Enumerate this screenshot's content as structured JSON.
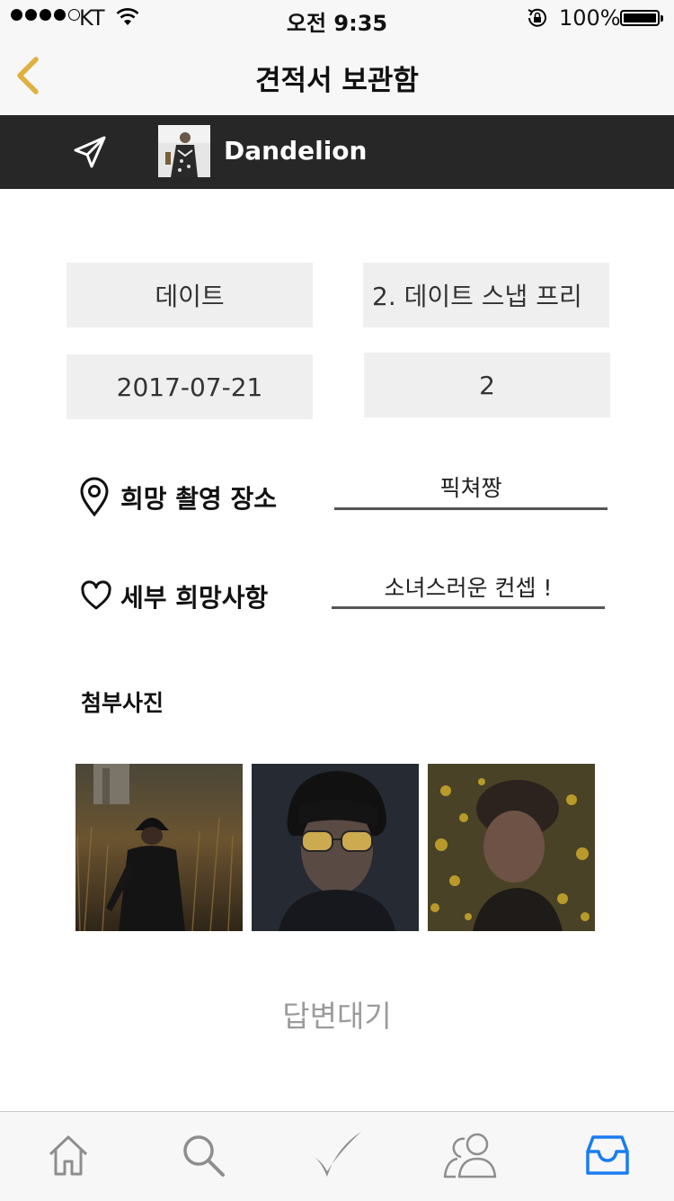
{
  "status_bar": {
    "carrier": "KT",
    "time": "오전 9:35",
    "battery_percent": "100%",
    "signal_bars": 4,
    "signal_total": 5
  },
  "nav": {
    "title": "견적서 보관함",
    "back_icon": "chevron-left-icon",
    "accent_color": "#e0b040"
  },
  "profile": {
    "name": "Dandelion",
    "send_icon": "paper-plane-icon"
  },
  "request": {
    "category": "데이트",
    "package": "2. 데이트 스냅 프리",
    "date": "2017-07-21",
    "count": "2"
  },
  "fields": {
    "location_label": "희망 촬영 장소",
    "location_value": "픽쳐짱",
    "location_icon": "map-pin-icon",
    "details_label": "세부 희망사항",
    "details_value": "소녀스러운 컨셉 !",
    "details_icon": "heart-icon"
  },
  "attachments": {
    "label": "첨부사진",
    "photos": [
      "photo-field-hat",
      "photo-yellow-glasses",
      "photo-beanie-flowers"
    ]
  },
  "status": "답변대기",
  "tabs": [
    {
      "icon": "home-icon",
      "active": false
    },
    {
      "icon": "search-icon",
      "active": false
    },
    {
      "icon": "check-icon",
      "active": false
    },
    {
      "icon": "users-icon",
      "active": false
    },
    {
      "icon": "inbox-icon",
      "active": true
    }
  ],
  "colors": {
    "tab_inactive": "#8e8e8e",
    "tab_active": "#1a7cf0",
    "profile_bar": "#272727",
    "status_text": "#9b9b9b"
  }
}
